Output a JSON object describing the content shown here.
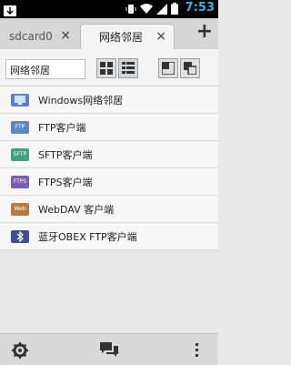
{
  "status_bar": {
    "time": "7:53",
    "icons": [
      "download-icon",
      "vibrate-icon",
      "wifi-icon",
      "signal-icon",
      "battery-icon"
    ]
  },
  "tabs": [
    {
      "label": "sdcard0",
      "close": "×",
      "active": false
    },
    {
      "label": "网络邻居",
      "close": "×",
      "active": true
    }
  ],
  "add_tab": "+",
  "path_field": {
    "value": "网络邻居"
  },
  "list": [
    {
      "label": "Windows网络邻居",
      "icon": "windows-network-icon",
      "color": "#5a7fd6",
      "tag": ""
    },
    {
      "label": "FTP客户端",
      "icon": "ftp-folder-icon",
      "color": "#5e86c8",
      "tag": "FTP"
    },
    {
      "label": "SFTP客户端",
      "icon": "sftp-folder-icon",
      "color": "#3fa37f",
      "tag": "SFTP"
    },
    {
      "label": "FTPS客户端",
      "icon": "ftps-folder-icon",
      "color": "#7a5fb0",
      "tag": "FTPS"
    },
    {
      "label": "WebDAV 客户端",
      "icon": "webdav-folder-icon",
      "color": "#b87c3a",
      "tag": "Web"
    },
    {
      "label": "蓝牙OBEX FTP客户端",
      "icon": "bluetooth-icon",
      "color": "#3f4f8e",
      "tag": ""
    }
  ],
  "bottom_bar": {
    "icons": [
      "settings-gear-icon",
      "chat-icon",
      "overflow-menu-icon"
    ]
  },
  "colors": {
    "clock": "#33b5e5",
    "statusbar": "#000000",
    "tabbar": "#d6d6d6",
    "content_bg": "#f7f7f7"
  }
}
